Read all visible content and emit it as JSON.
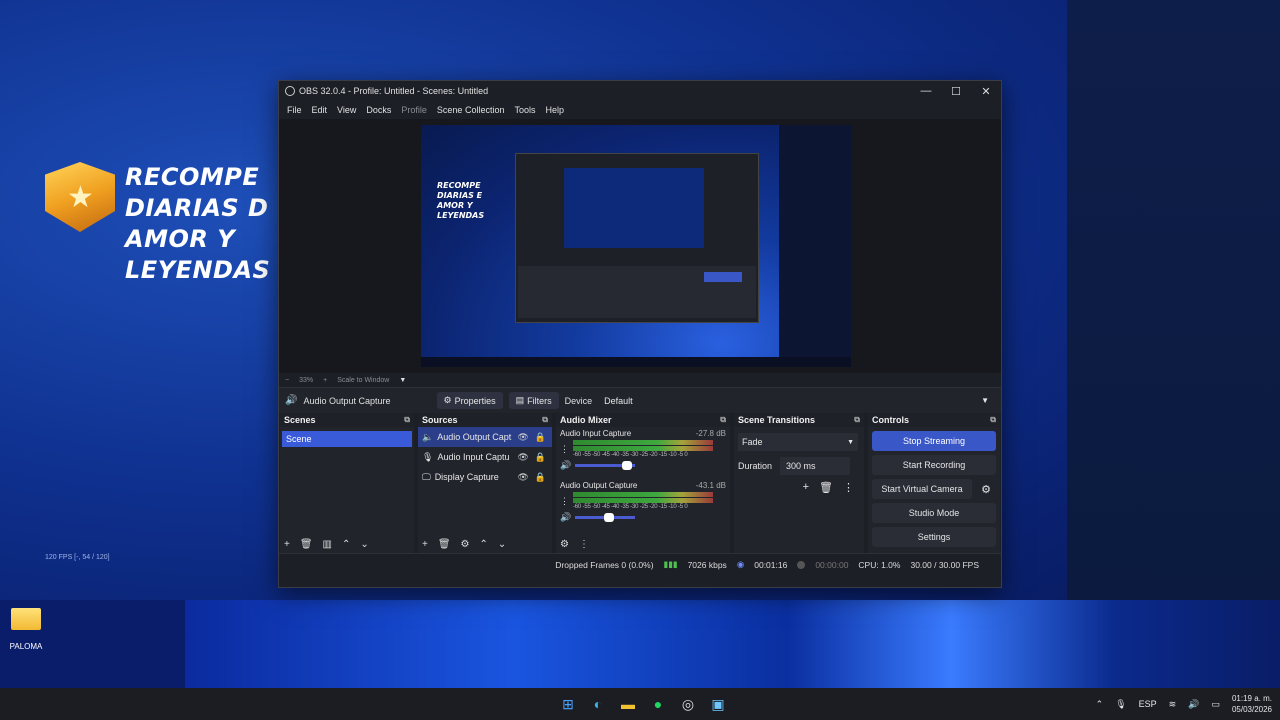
{
  "desktop": {
    "promo_lines": [
      "RECOMPE",
      "DIARIAS D",
      "AMOR Y",
      "LEYENDAS"
    ],
    "fps_note": "120 FPS [-, 54 / 120]",
    "icon_label": "PALOMA"
  },
  "window": {
    "title": "OBS 32.0.4 - Profile: Untitled - Scenes: Untitled",
    "minimize": "—",
    "maximize": "☐",
    "close": "✕"
  },
  "menu": [
    "File",
    "Edit",
    "View",
    "Docks",
    "Profile",
    "Scene Collection",
    "Tools",
    "Help"
  ],
  "preview": {
    "promo_lines": [
      "RECOMPE",
      "DIARIAS E",
      "AMOR Y",
      "LEYENDAS"
    ],
    "zoom_minus": "−",
    "zoom": "33%",
    "zoom_plus": "+",
    "scale_label": "Scale to Window",
    "scale_caret": "▼"
  },
  "source_toolbar": {
    "source_name": "Audio Output Capture",
    "properties": "Properties",
    "filters": "Filters",
    "device_label": "Device",
    "device_value": "Default"
  },
  "scenes": {
    "title": "Scenes",
    "items": [
      "Scene"
    ]
  },
  "sources": {
    "title": "Sources",
    "items": [
      "Audio Output Capt",
      "Audio Input Captu",
      "Display Capture"
    ]
  },
  "mixer": {
    "title": "Audio Mixer",
    "scale": "-60 -55 -50 -45 -40 -35 -30 -25 -20 -15 -10 -5 0",
    "channels": [
      {
        "name": "Audio Input Capture",
        "db": "-27.8 dB",
        "volume": 0.95
      },
      {
        "name": "Audio Output Capture",
        "db": "-43.1 dB",
        "volume": 0.65
      }
    ]
  },
  "transitions": {
    "title": "Scene Transitions",
    "selected": "Fade",
    "duration_label": "Duration",
    "duration_value": "300 ms"
  },
  "controls": {
    "title": "Controls",
    "stop_streaming": "Stop Streaming",
    "start_recording": "Start Recording",
    "start_virtual_camera": "Start Virtual Camera",
    "studio_mode": "Studio Mode",
    "settings": "Settings"
  },
  "status": {
    "dropped_frames": "Dropped Frames 0 (0.0%)",
    "bitrate": "7026 kbps",
    "stream_time": "00:01:16",
    "rec_time": "00:00:00",
    "cpu": "CPU: 1.0%",
    "fps": "30.00 / 30.00 FPS"
  },
  "taskbar": {
    "lang": "ESP",
    "time": "01:19 a. m.",
    "date": "05/03/2026"
  },
  "colors": {
    "accent": "#3a57c8",
    "stream_active": "#3a57c8"
  }
}
